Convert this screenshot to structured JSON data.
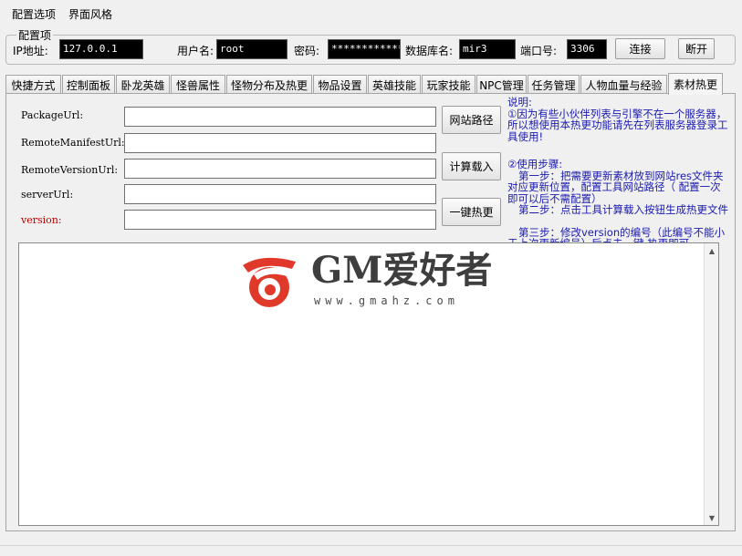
{
  "menu": {
    "config_options": "配置选项",
    "theme": "界面风格"
  },
  "config_group": {
    "title": "配置项",
    "ip_label": "IP地址:",
    "ip_value": "127.0.0.1",
    "user_label": "用户名:",
    "user_value": "root",
    "password_label": "密码:",
    "password_value": "*************",
    "db_label": "数据库名:",
    "db_value": "mir3",
    "port_label": "端口号:",
    "port_value": "3306",
    "connect_button": "连接",
    "disconnect_button": "断开"
  },
  "tabs": [
    {
      "label": "快捷方式"
    },
    {
      "label": "控制面板"
    },
    {
      "label": "卧龙英雄"
    },
    {
      "label": "怪兽属性"
    },
    {
      "label": "怪物分布及热更"
    },
    {
      "label": "物品设置"
    },
    {
      "label": "英雄技能"
    },
    {
      "label": "玩家技能"
    },
    {
      "label": "NPC管理"
    },
    {
      "label": "任务管理"
    },
    {
      "label": "人物血量与经验"
    },
    {
      "label": "素材热更"
    }
  ],
  "active_tab": "素材热更",
  "form": {
    "package_url_label": "PackageUrl:",
    "remote_manifest_label": "RemoteManifestUrl:",
    "remote_version_label": "RemoteVersionUrl:",
    "server_url_label": "serverUrl:",
    "version_label": "version:",
    "website_path_button": "网站路径",
    "compute_load_button": "计算载入",
    "one_click_button": "一键热更"
  },
  "description": {
    "title": "说明:",
    "line1": "①因为有些小伙伴列表与引擎不在一个服务器，所以想使用本热更功能请先在列表服务器登录工具使用!",
    "steps_title": "②使用步骤:",
    "step1": "第一步：把需要更新素材放到网站res文件夹对应更新位置，配置工具网站路径（  配置一次即可以后不需配置）",
    "step2": "第二步：点击工具计算载入按钮生成热更文件",
    "step3": "第三步：修改version的编号（此编号不能小于上次更新编号）后点击一键  热更即可"
  },
  "watermark": {
    "name": "GM爱好者",
    "domain": "www.gmahz.com"
  },
  "colors": {
    "version_label": "#c00000",
    "description_text": "#1a1ab0",
    "logo_red": "#e0392a",
    "dark_field_bg": "#000000"
  }
}
